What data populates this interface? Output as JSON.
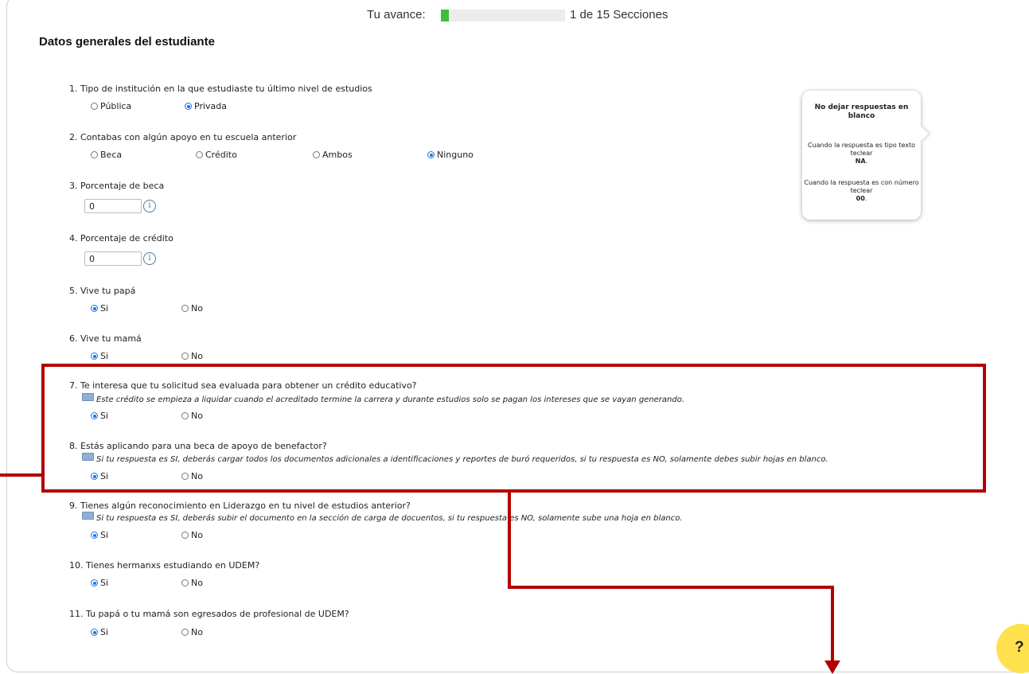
{
  "progress": {
    "label": "Tu avance:",
    "value": 0.0667,
    "count_text": "1 de 15 Secciones",
    "fill_color": "#3bbf3b"
  },
  "section_title": "Datos generales del estudiante",
  "questions": [
    {
      "text": "1. Tipo de institución en la que estudiaste tu último nivel de estudios",
      "options": [
        "Pública",
        "Privada"
      ],
      "selected": "Privada"
    },
    {
      "text": "2. Contabas con algún apoyo en tu escuela anterior",
      "options": [
        "Beca",
        "Crédito",
        "Ambos",
        "Ninguno"
      ],
      "selected": "Ninguno"
    },
    {
      "text": "3. Porcentaje de beca",
      "value": "0"
    },
    {
      "text": "4. Porcentaje de crédito",
      "value": "0"
    },
    {
      "text": "5. Vive tu papá",
      "options": [
        "Si",
        "No"
      ],
      "selected": "Si"
    },
    {
      "text": "6. Vive tu mamá",
      "options": [
        "Si",
        "No"
      ],
      "selected": "Si"
    },
    {
      "text": "7. Te interesa que tu solicitud sea evaluada para obtener un crédito educativo?",
      "note": "Este crédito se empieza a liquidar cuando el acreditado termine la carrera y durante estudios solo se pagan los intereses que se vayan generando.",
      "options": [
        "Si",
        "No"
      ],
      "selected": "Si"
    },
    {
      "text": "8. Estás aplicando para una beca de apoyo de benefactor?",
      "note": "Si tu respuesta es SI, deberás cargar todos los documentos adicionales a identificaciones y reportes de buró requeridos, si tu respuesta es NO, solamente debes subir hojas en blanco.",
      "options": [
        "Si",
        "No"
      ],
      "selected": "Si"
    },
    {
      "text": "9. Tienes algún reconocimiento en Liderazgo en tu nivel de estudios anterior?",
      "note": "Si tu respuesta es SI, deberás subir el documento en la sección de carga de docuentos, si tu respuesta es NO, solamente sube una hoja en blanco.",
      "options": [
        "Si",
        "No"
      ],
      "selected": "Si"
    },
    {
      "text": "10. Tienes hermanxs estudiando en UDEM?",
      "options": [
        "Si",
        "No"
      ],
      "selected": "Si"
    },
    {
      "text": "11. Tu papá o tu mamá son egresados de profesional de UDEM?",
      "options": [
        "Si",
        "No"
      ],
      "selected": "Si"
    }
  ],
  "tooltip": {
    "heading": "No dejar respuestas en blanco",
    "text_case_1": "Cuando la respuesta es tipo texto teclear",
    "text_case_1_value": "NA",
    "number_case_1": "Cuando la respuesta es con número teclear",
    "number_case_1_value": "00"
  },
  "help_button": {
    "label": "?",
    "color": "#ffe14d"
  },
  "colors": {
    "highlight": "#b30000",
    "radio_selected": "#1a73e8",
    "note_icon": "#8fb0d6"
  },
  "icons": {
    "info": "info-circle-icon",
    "note": "comment-icon",
    "help": "question-icon"
  }
}
